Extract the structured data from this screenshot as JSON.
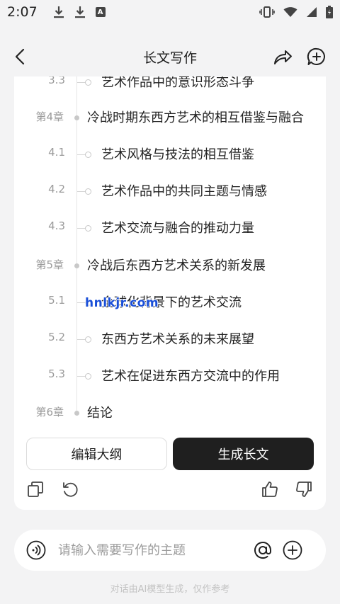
{
  "status_bar": {
    "time": "2:07"
  },
  "header": {
    "title": "长文写作"
  },
  "outline": {
    "partial_row": {
      "num": "3.3",
      "text": "艺术作品中的意识形态斗争"
    },
    "rows": [
      {
        "kind": "chapter",
        "num": "第4章",
        "text": "冷战时期东西方艺术的相互借鉴与融合"
      },
      {
        "kind": "section",
        "num": "4.1",
        "text": "艺术风格与技法的相互借鉴"
      },
      {
        "kind": "section",
        "num": "4.2",
        "text": "艺术作品中的共同主题与情感"
      },
      {
        "kind": "section",
        "num": "4.3",
        "text": "艺术交流与融合的推动力量"
      },
      {
        "kind": "chapter",
        "num": "第5章",
        "text": "冷战后东西方艺术关系的新发展"
      },
      {
        "kind": "section",
        "num": "5.1",
        "text": "全球化背景下的艺术交流"
      },
      {
        "kind": "section",
        "num": "5.2",
        "text": "东西方艺术关系的未来展望"
      },
      {
        "kind": "section",
        "num": "5.3",
        "text": "艺术在促进东西方交流中的作用"
      },
      {
        "kind": "chapter",
        "num": "第6章",
        "text": "结论"
      }
    ]
  },
  "watermark": "hnlkjr.com",
  "buttons": {
    "edit_outline": "编辑大纲",
    "generate_long_text": "生成长文"
  },
  "input": {
    "placeholder": "请输入需要写作的主题"
  },
  "disclaimer": "对话由AI模型生成，仅作参考",
  "icons": {
    "back": "chevron-left-icon",
    "share": "share-arrow-icon",
    "new_chat": "chat-plus-icon",
    "copy": "copy-icon",
    "regenerate": "refresh-icon",
    "like": "thumbs-up-icon",
    "dislike": "thumbs-down-icon",
    "voice": "voice-icon",
    "mention": "at-icon",
    "add": "plus-circle-icon"
  }
}
